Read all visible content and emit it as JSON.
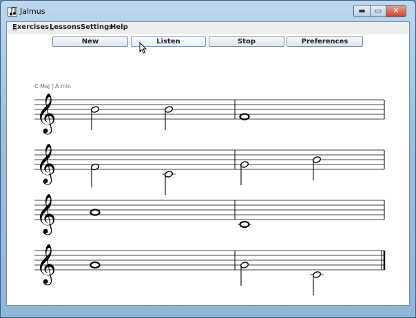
{
  "window": {
    "title": "Jalmus",
    "min_label": "▬",
    "max_label": "▭",
    "close_label": "✕"
  },
  "menu": [
    {
      "label": "Exercises",
      "mnemonic": "E"
    },
    {
      "label": "Lessons",
      "mnemonic": "L"
    },
    {
      "label": "Settings",
      "mnemonic": ""
    },
    {
      "label": "Help",
      "mnemonic": ""
    }
  ],
  "toolbar": {
    "new_label": "New",
    "listen_label": "Listen",
    "stop_label": "Stop",
    "preferences_label": "Preferences"
  },
  "score": {
    "key_signature_label": "C Maj | A min",
    "clef": "treble",
    "systems": [
      {
        "measures": [
          {
            "notes": [
              {
                "pitch": "B4",
                "duration": "half"
              },
              {
                "pitch": "B4",
                "duration": "half"
              }
            ]
          },
          {
            "notes": [
              {
                "pitch": "F4",
                "duration": "whole"
              }
            ]
          }
        ]
      },
      {
        "measures": [
          {
            "notes": [
              {
                "pitch": "F4",
                "duration": "half"
              },
              {
                "pitch": "C4",
                "duration": "half"
              }
            ]
          },
          {
            "notes": [
              {
                "pitch": "G4",
                "duration": "half"
              },
              {
                "pitch": "B4",
                "duration": "half"
              }
            ]
          }
        ]
      },
      {
        "measures": [
          {
            "notes": [
              {
                "pitch": "A4",
                "duration": "whole"
              }
            ]
          },
          {
            "notes": [
              {
                "pitch": "C4",
                "duration": "whole"
              }
            ]
          }
        ]
      },
      {
        "measures": [
          {
            "notes": [
              {
                "pitch": "G4",
                "duration": "whole"
              }
            ]
          },
          {
            "notes": [
              {
                "pitch": "G4",
                "duration": "half"
              },
              {
                "pitch": "C4",
                "duration": "half"
              }
            ]
          }
        ],
        "final_barline": true
      }
    ]
  },
  "colors": {
    "accent": "#6d9ad1",
    "frame": "#9cc0e0"
  }
}
